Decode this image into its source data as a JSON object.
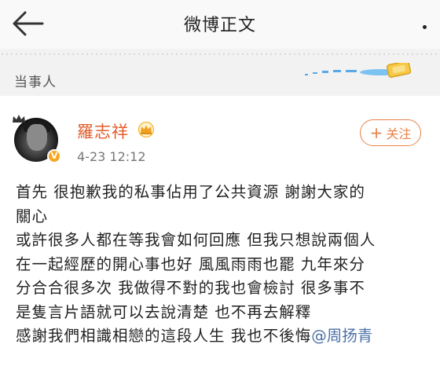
{
  "navbar": {
    "title": "微博正文",
    "back_icon": "arrow-left-icon",
    "more_icon": "more-dots-icon"
  },
  "section": {
    "label": "当事人"
  },
  "post": {
    "author": {
      "name": "羅志祥",
      "badge_icon": "crown-icon",
      "verified_icon": "verified-v-icon",
      "verified_text": "V"
    },
    "time": "4-23 12:12",
    "follow_button": {
      "plus": "+",
      "label": "关注"
    },
    "lines": [
      "首先 很抱歉我的私事佔用了公共資源 謝謝大家的",
      "關心",
      "或許很多人都在等我會如何回應 但我只想說兩個人",
      "在一起經歷的開心事也好 風風雨雨也罷 九年來分",
      "分合合很多次 我做得不對的我也會檢討 很多事不",
      "是隻言片語就可以去說清楚 也不再去解釋"
    ],
    "last_line": "感謝我們相識相戀的這段人生 我也不後悔",
    "mention": "@周扬青"
  },
  "colors": {
    "username": "#e25d2b",
    "follow": "#e8824a",
    "mention": "#4a6fa5",
    "badge": "#f5a623"
  }
}
